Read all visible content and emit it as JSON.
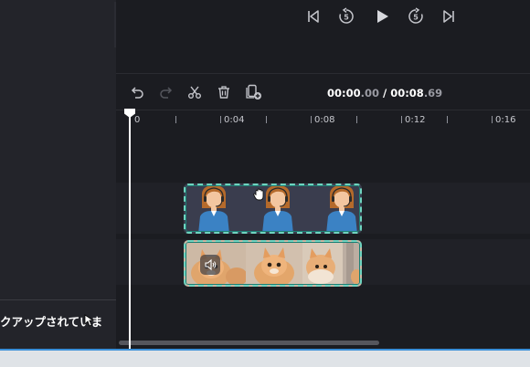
{
  "sidebar": {
    "status_text": "クアップされていま",
    "collapse_icon": "chevron-left-icon"
  },
  "player": {
    "controls": [
      "skip-back-icon",
      "rewind-5-icon",
      "play-icon",
      "forward-5-icon",
      "skip-forward-icon"
    ],
    "rewind_label": "5",
    "forward_label": "5"
  },
  "toolbar": {
    "time_current_main": "00:00",
    "time_current_frac": ".00",
    "time_separator": " / ",
    "time_total_main": "00:08",
    "time_total_frac": ".69"
  },
  "ruler": {
    "labels": [
      "0",
      "0:04",
      "0:08",
      "0:12",
      "0:16"
    ]
  },
  "tracks": {
    "video": {
      "type": "avatar video",
      "frames": 3
    },
    "audio": {
      "type": "kitten video with audio",
      "audio_icon": "speaker-icon"
    }
  },
  "colors": {
    "accent": "#6fd3bf",
    "background": "#1b1c21",
    "sidebar": "#23242a"
  }
}
